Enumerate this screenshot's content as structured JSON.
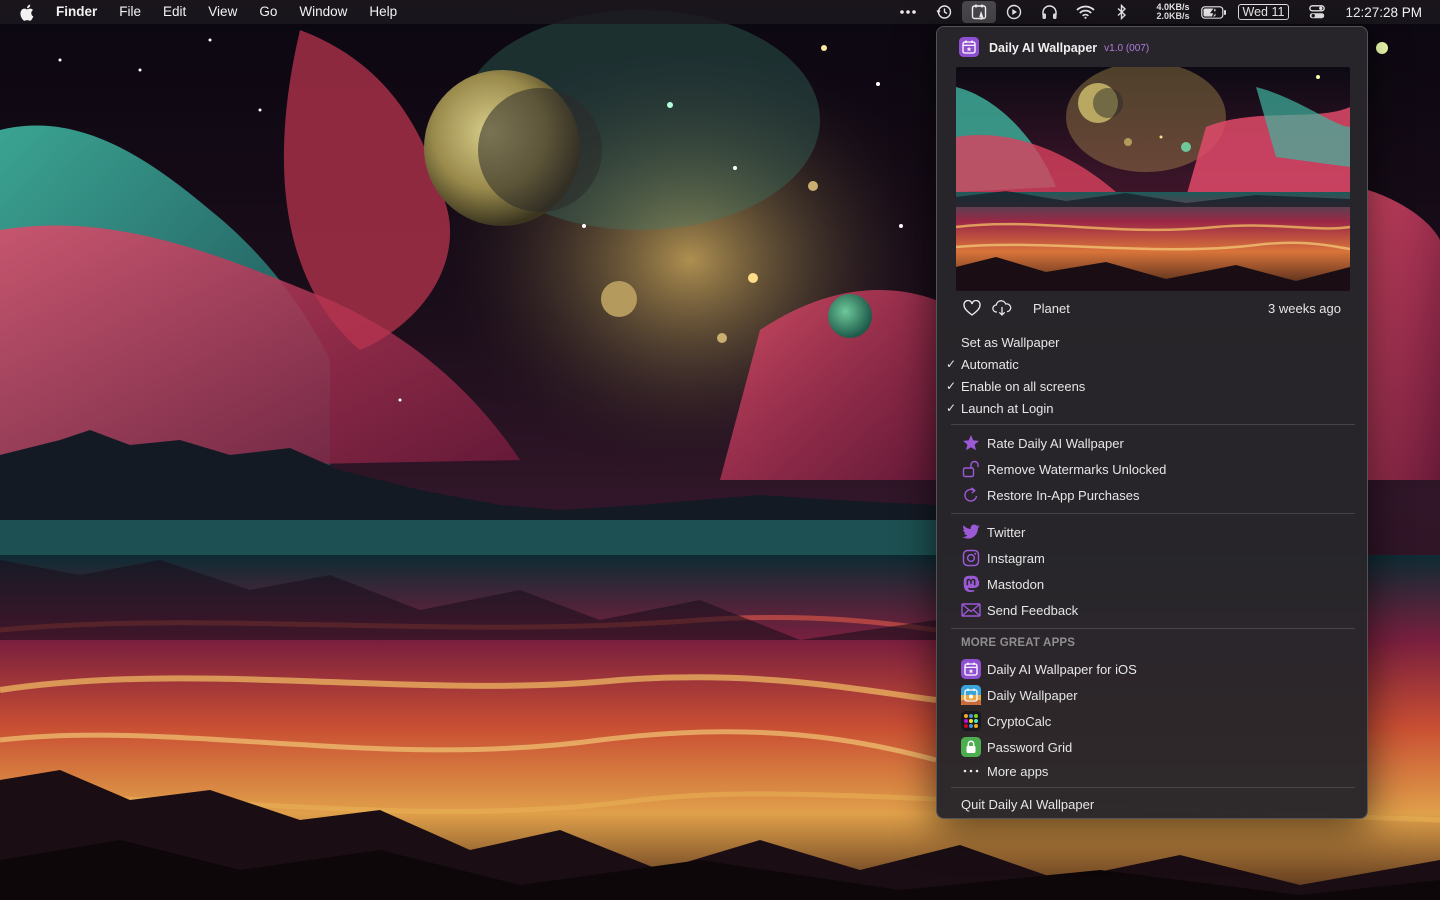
{
  "menubar": {
    "app_name": "Finder",
    "menus": [
      "File",
      "Edit",
      "View",
      "Go",
      "Window",
      "Help"
    ],
    "net_up": "4.0KB/s",
    "net_down": "2.0KB/s",
    "date": "Wed 11",
    "time": "12:27:28 PM"
  },
  "popup": {
    "app_name": "Daily AI Wallpaper",
    "version": "v1.0 (007)",
    "wallpaper_title": "Planet",
    "wallpaper_age": "3 weeks ago",
    "options": [
      {
        "label": "Set as Wallpaper",
        "checked": false
      },
      {
        "label": "Automatic",
        "checked": true
      },
      {
        "label": "Enable on all screens",
        "checked": true
      },
      {
        "label": "Launch at Login",
        "checked": true
      }
    ],
    "store_items": [
      {
        "label": "Rate Daily AI Wallpaper",
        "icon": "star-icon"
      },
      {
        "label": "Remove Watermarks Unlocked",
        "icon": "unlock-icon"
      },
      {
        "label": "Restore In-App Purchases",
        "icon": "refresh-icon"
      }
    ],
    "social_items": [
      {
        "label": "Twitter",
        "icon": "twitter-icon"
      },
      {
        "label": "Instagram",
        "icon": "instagram-icon"
      },
      {
        "label": "Mastodon",
        "icon": "mastodon-icon"
      },
      {
        "label": "Send Feedback",
        "icon": "envelope-icon"
      }
    ],
    "more_apps_heading": "MORE GREAT APPS",
    "apps": [
      {
        "label": "Daily AI Wallpaper for iOS",
        "icon": "calendar-app-icon"
      },
      {
        "label": "Daily Wallpaper",
        "icon": "photo-app-icon"
      },
      {
        "label": "CryptoCalc",
        "icon": "cryptocalc-app-icon"
      },
      {
        "label": "Password Grid",
        "icon": "lock-app-icon"
      },
      {
        "label": "More apps",
        "icon": "ellipsis-icon"
      }
    ],
    "quit_label": "Quit Daily AI Wallpaper"
  },
  "colors": {
    "accent": "#9b59d6",
    "checked": "#ffffff",
    "separator": "#3a383c"
  }
}
